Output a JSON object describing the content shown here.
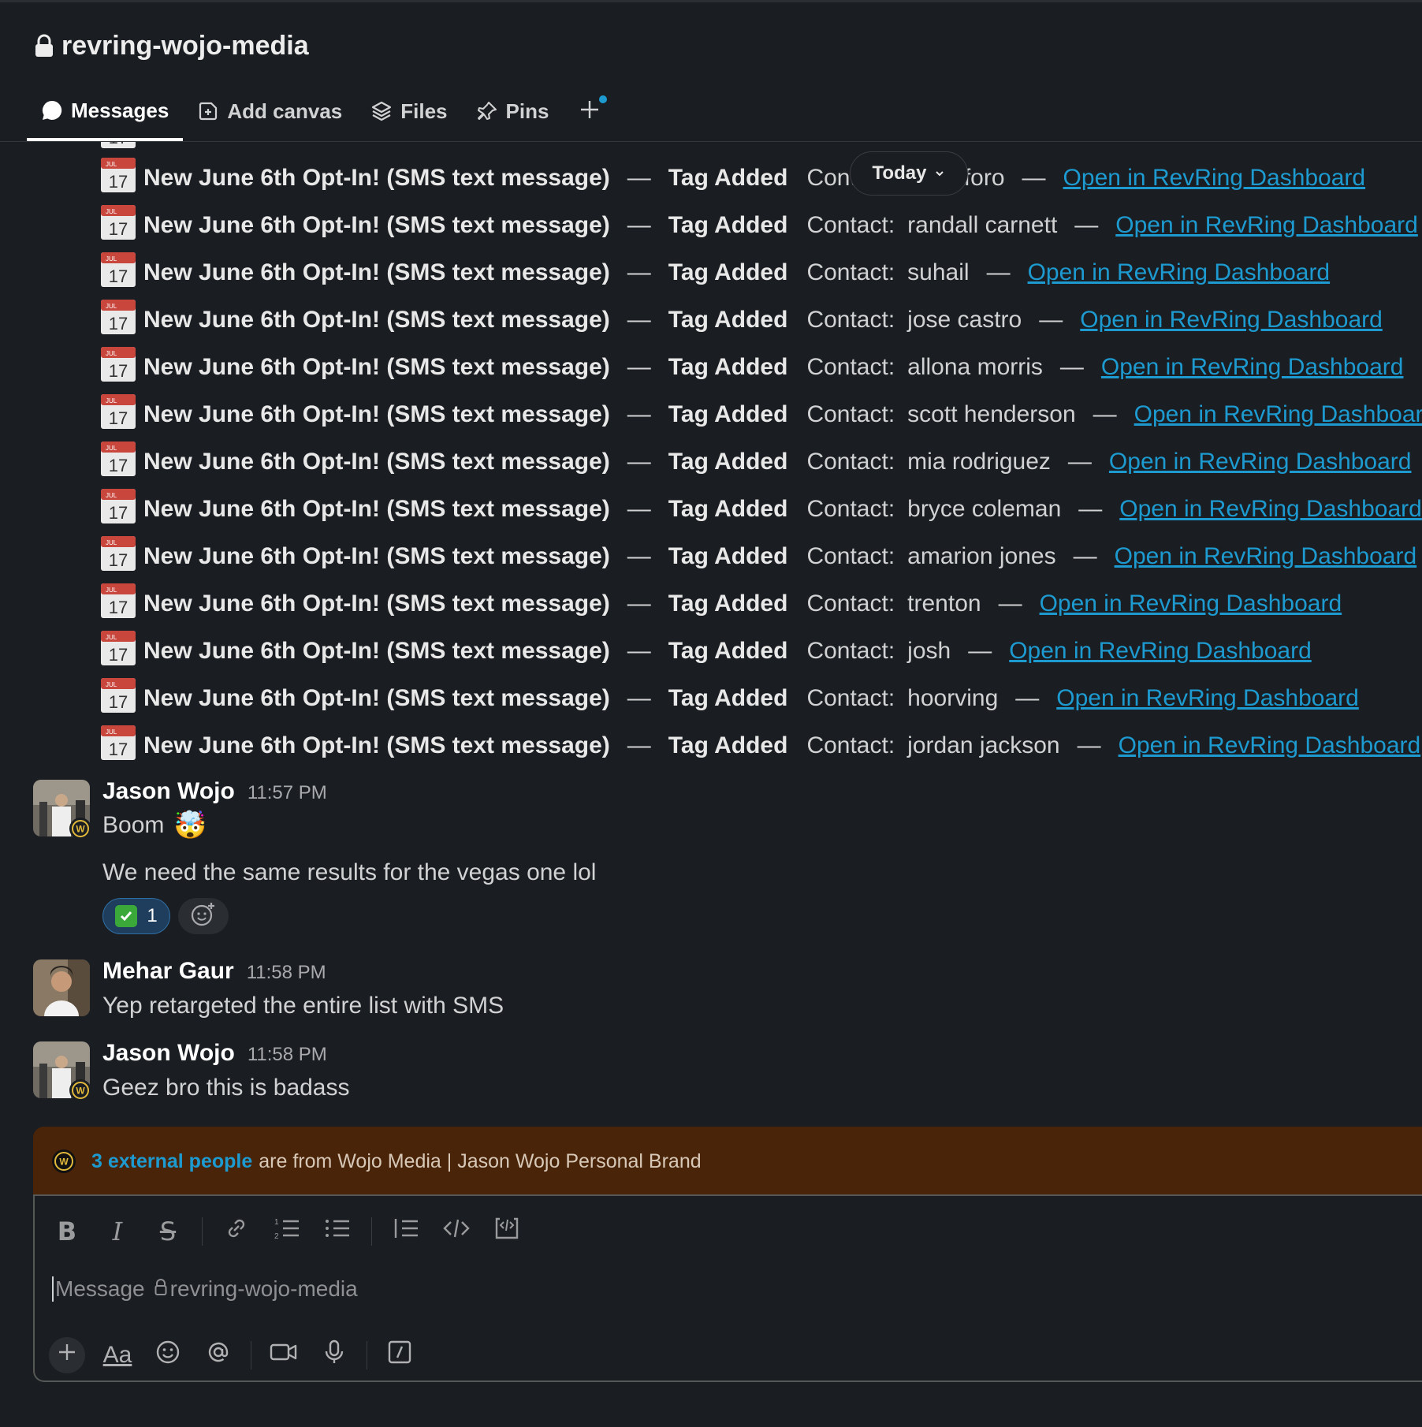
{
  "channel": {
    "name": "revring-wojo-media"
  },
  "tabs": [
    {
      "label": "Messages"
    },
    {
      "label": "Add canvas"
    },
    {
      "label": "Files"
    },
    {
      "label": "Pins"
    }
  ],
  "separator": {
    "label": "Today"
  },
  "calendar_icon": {
    "month": "JUL",
    "day": "17"
  },
  "notification": {
    "title": "New June 6th Opt-In! (SMS text message)",
    "dash": "—",
    "tag": "Tag Added",
    "contact_label": "Contact:",
    "link": "Open in RevRing Dashboard"
  },
  "rows": [
    {
      "contact": "cristoforo"
    },
    {
      "contact": "randall carnett"
    },
    {
      "contact": "suhail"
    },
    {
      "contact": "jose castro"
    },
    {
      "contact": "allona morris"
    },
    {
      "contact": "scott henderson"
    },
    {
      "contact": "mia rodriguez"
    },
    {
      "contact": "bryce coleman"
    },
    {
      "contact": "amarion jones"
    },
    {
      "contact": "trenton"
    },
    {
      "contact": "josh"
    },
    {
      "contact": "hoorving"
    },
    {
      "contact": "jordan jackson"
    }
  ],
  "messages": [
    {
      "author": "Jason Wojo",
      "time": "11:57 PM",
      "lines": [
        "Boom",
        "We need the same results for the vegas one lol"
      ],
      "emoji": "🤯"
    },
    {
      "author": "Mehar Gaur",
      "time": "11:58 PM",
      "lines": [
        "Yep retargeted the entire list with SMS"
      ]
    },
    {
      "author": "Jason Wojo",
      "time": "11:58 PM",
      "lines": [
        "Geez bro this is badass"
      ]
    }
  ],
  "reaction": {
    "count": "1"
  },
  "banner": {
    "link": "3 external people",
    "text": "are from Wojo Media | Jason Wojo Personal Brand"
  },
  "composer": {
    "placeholder": "Message",
    "channel": "revring-wojo-media",
    "aa": "Aa"
  },
  "colors": {
    "background": "#1a1d21",
    "link": "#1d9bd1",
    "banner": "#4a2408"
  }
}
